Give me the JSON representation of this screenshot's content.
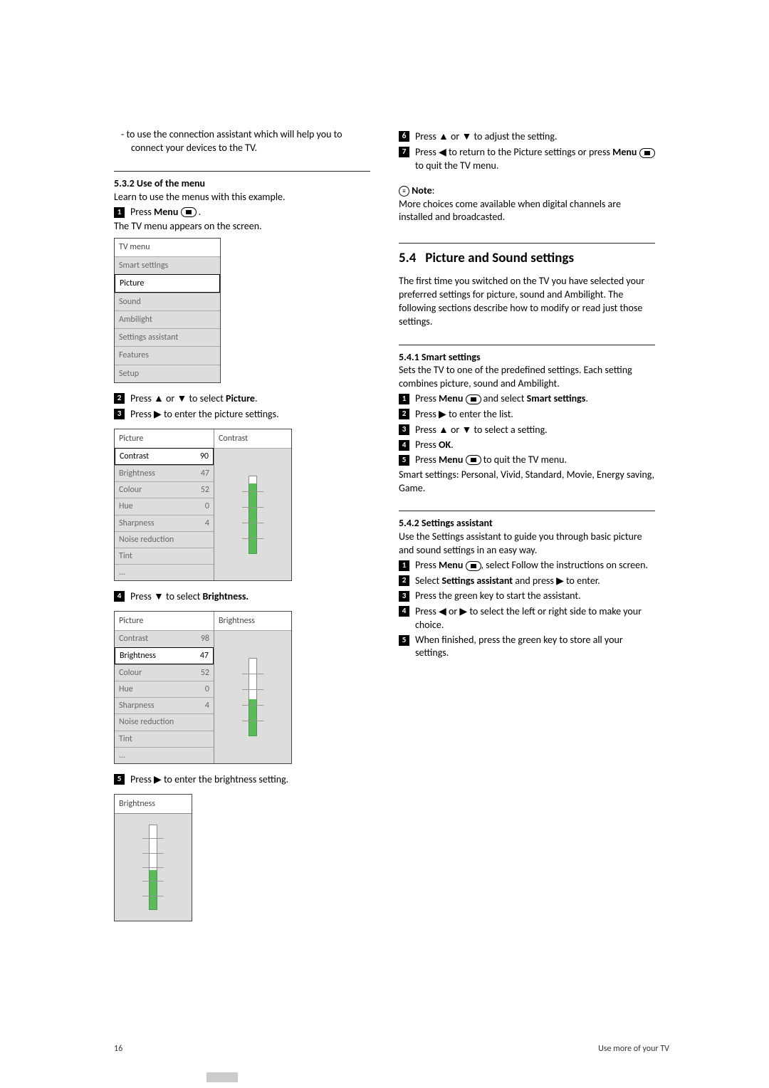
{
  "left": {
    "intro_bullet": "-  to use the connection assistant which will help you to connect your devices to the TV.",
    "sec_title": "5.3.2    Use of the menu",
    "sec_para": "Learn to use the menus with this example.",
    "step1_a": "Press ",
    "step1_menu": "Menu",
    "step1_b": " .",
    "after1": "The TV menu appears on the screen.",
    "tvmenu": {
      "title": "TV menu",
      "items": [
        "Smart settings",
        "Picture",
        "Sound",
        "Ambilight",
        "Settings assistant",
        "Features",
        "Setup"
      ]
    },
    "step2_a": "Press ",
    "step2_up": "▲",
    "step2_mid": " or ",
    "step2_down": "▼",
    "step2_b": " to select ",
    "step2_picture": "Picture",
    "step2_c": ".",
    "step3_a": "Press ",
    "step3_right": "▶",
    "step3_b": " to enter the picture settings.",
    "panel1": {
      "header_left": "Picture",
      "header_right": "Contrast",
      "rows": [
        {
          "k": "Contrast",
          "v": "90"
        },
        {
          "k": "Brightness",
          "v": "47"
        },
        {
          "k": "Colour",
          "v": "52"
        },
        {
          "k": "Hue",
          "v": "0"
        },
        {
          "k": "Sharpness",
          "v": "4"
        },
        {
          "k": "Noise reduction",
          "v": ""
        },
        {
          "k": "Tint",
          "v": ""
        },
        {
          "k": "...",
          "v": ""
        }
      ],
      "fill_pct": 90
    },
    "step4_a": "Press ",
    "step4_down": "▼",
    "step4_b": " to select ",
    "step4_bold": "Brightness.",
    "panel2": {
      "header_left": "Picture",
      "header_right": "Brightness",
      "rows": [
        {
          "k": "Contrast",
          "v": "98"
        },
        {
          "k": "Brightness",
          "v": "47"
        },
        {
          "k": "Colour",
          "v": "52"
        },
        {
          "k": "Hue",
          "v": "0"
        },
        {
          "k": "Sharpness",
          "v": "4"
        },
        {
          "k": "Noise reduction",
          "v": ""
        },
        {
          "k": "Tint",
          "v": ""
        },
        {
          "k": "...",
          "v": ""
        }
      ],
      "fill_pct": 47
    },
    "step5_a": "Press ",
    "step5_right": "▶",
    "step5_b": " to enter the brightness setting.",
    "panel3": {
      "header": "Brightness",
      "fill_pct": 47
    }
  },
  "right": {
    "step6_a": "Press ",
    "step6_up": "▲",
    "step6_mid": " or ",
    "step6_down": "▼",
    "step6_b": " to adjust the setting.",
    "step7_a": "Press ",
    "step7_left": "◀",
    "step7_b": " to return to the Picture settings or press ",
    "step7_menu": "Menu",
    "step7_c": " to quit the TV menu.",
    "note_label": "Note",
    "note_colon": ":",
    "note_body": "More choices come available when digital channels are installed and broadcasted.",
    "h2_num": "5.4",
    "h2_title": "Picture and Sound settings",
    "h2_para": "The first time you switched on the TV you have selected your preferred settings for picture, sound and Ambilight. The following sections describe how to modify or read just those settings.",
    "s541_title": "5.4.1    Smart settings",
    "s541_para": "Sets the TV to one of the predefined settings. Each setting combines picture, sound and Ambilight.",
    "s541_step1_a": "Press ",
    "s541_step1_menu": "Menu",
    "s541_step1_b": " and select ",
    "s541_step1_bold": "Smart settings",
    "s541_step1_c": ".",
    "s541_step2_a": "Press ",
    "s541_step2_right": "▶",
    "s541_step2_b": " to enter the list.",
    "s541_step3_a": "Press ",
    "s541_step3_up": "▲",
    "s541_step3_mid": " or ",
    "s541_step3_down": "▼",
    "s541_step3_b": " to select a setting.",
    "s541_step4_a": "Press ",
    "s541_step4_ok": "OK",
    "s541_step4_b": ".",
    "s541_step5_a": "Press ",
    "s541_step5_menu": "Menu",
    "s541_step5_b": " to quit the TV menu.",
    "s541_after": "Smart settings: Personal, Vivid, Standard, Movie, Energy saving, Game.",
    "s542_title": "5.4.2    Settings assistant",
    "s542_para": "Use the Settings assistant to guide you through basic picture and sound settings in an easy way.",
    "s542_step1_a": "Press ",
    "s542_step1_menu": "Menu",
    "s542_step1_b": ", select Follow the instructions on screen.",
    "s542_step2_a": "Select ",
    "s542_step2_bold": "Settings assistant",
    "s542_step2_b": " and press ",
    "s542_step2_right": "▶",
    "s542_step2_c": " to enter.",
    "s542_step3": "Press the green key to start the assistant.",
    "s542_step4_a": "Press ",
    "s542_step4_left": "◀",
    "s542_step4_mid": " or ",
    "s542_step4_right": "▶",
    "s542_step4_b": " to select the left or right side to make your choice.",
    "s542_step5": "When finished, press the green key to store all your settings."
  },
  "footer": {
    "page": "16",
    "label": "Use more of your TV"
  }
}
